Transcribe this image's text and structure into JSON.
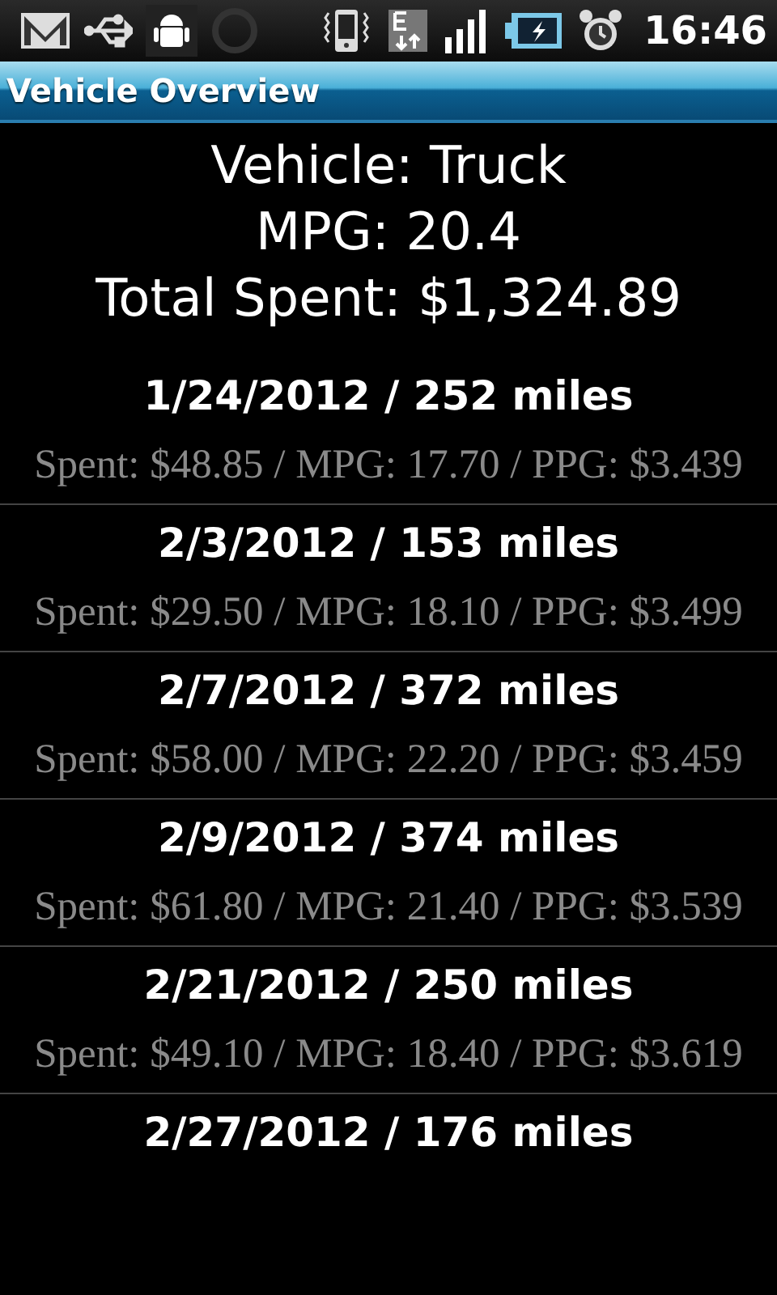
{
  "status_bar": {
    "time": "16:46"
  },
  "window": {
    "title": "Vehicle Overview"
  },
  "summary": [
    "Vehicle: Truck",
    "MPG: 20.4",
    "Total Spent: $1,324.89"
  ],
  "entries": [
    {
      "title": "1/24/2012 / 252 miles",
      "detail": "Spent: $48.85 / MPG: 17.70 / PPG: $3.439"
    },
    {
      "title": "2/3/2012 / 153 miles",
      "detail": "Spent: $29.50 / MPG: 18.10 / PPG: $3.499"
    },
    {
      "title": "2/7/2012 / 372 miles",
      "detail": "Spent: $58.00 / MPG: 22.20 / PPG: $3.459"
    },
    {
      "title": "2/9/2012 / 374 miles",
      "detail": "Spent: $61.80 / MPG: 21.40 / PPG: $3.539"
    },
    {
      "title": "2/21/2012 / 250 miles",
      "detail": "Spent: $49.10 / MPG: 18.40 / PPG: $3.619"
    },
    {
      "title": "2/27/2012 / 176 miles"
    }
  ]
}
